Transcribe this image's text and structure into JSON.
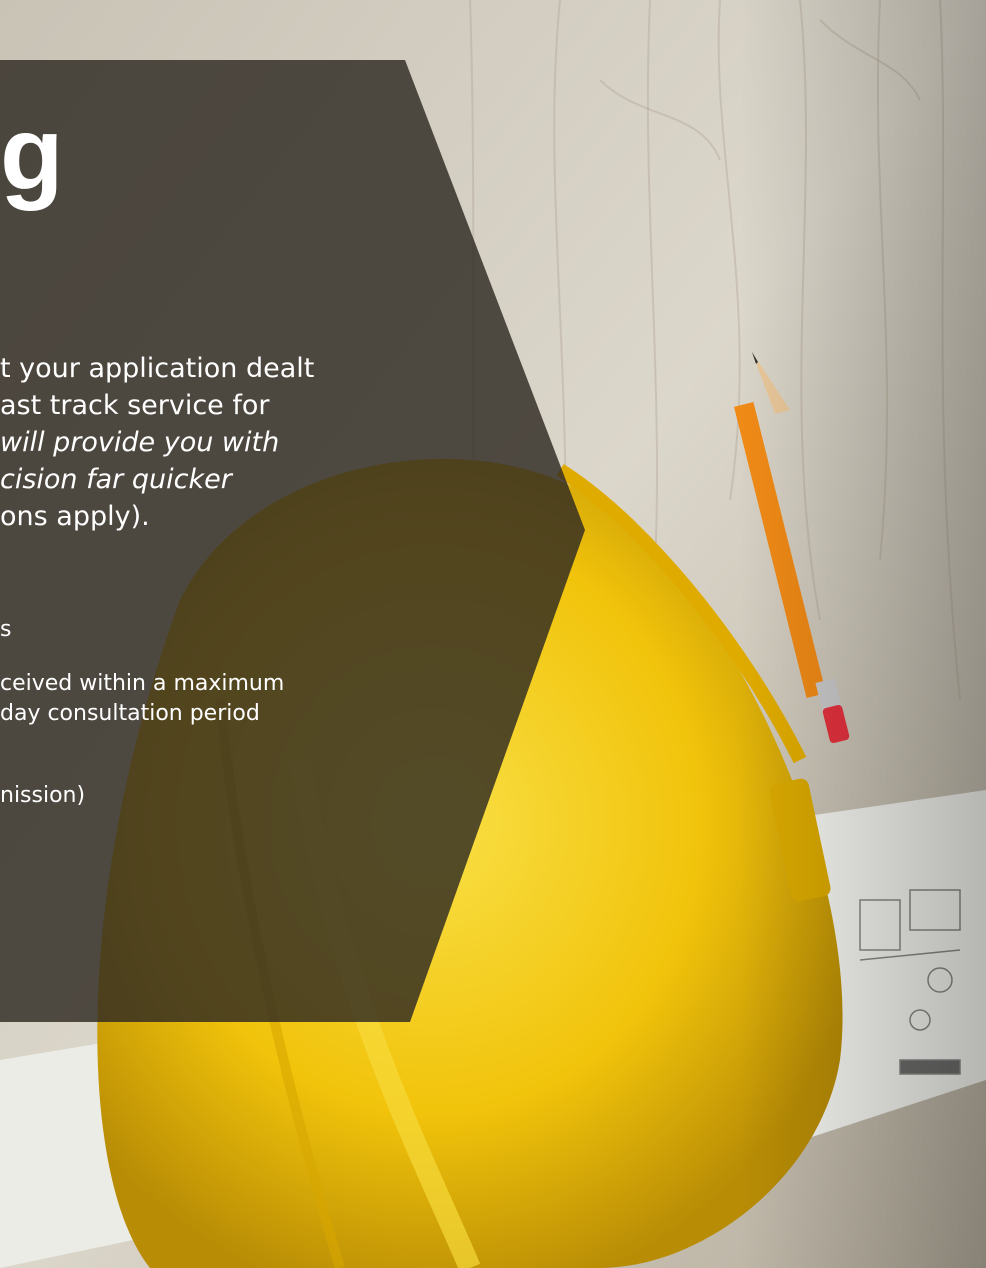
{
  "heading": "g",
  "intro": {
    "line1": "t your application dealt",
    "line2": "ast track service for",
    "line3": "will provide you with",
    "line4": "cision far quicker",
    "line5": "ons apply)."
  },
  "bullets": {
    "line1": "s",
    "line2": "ceived within a maximum",
    "line3": "day consultation period",
    "line4": "nission)"
  },
  "colors": {
    "panel": "#2e2a22",
    "helmet": "#f2c80c",
    "wood": "#cdc8bc",
    "pencil": "#f08a16"
  },
  "icons": [
    "hard-hat-image",
    "pencil-image",
    "blueprint-image"
  ]
}
